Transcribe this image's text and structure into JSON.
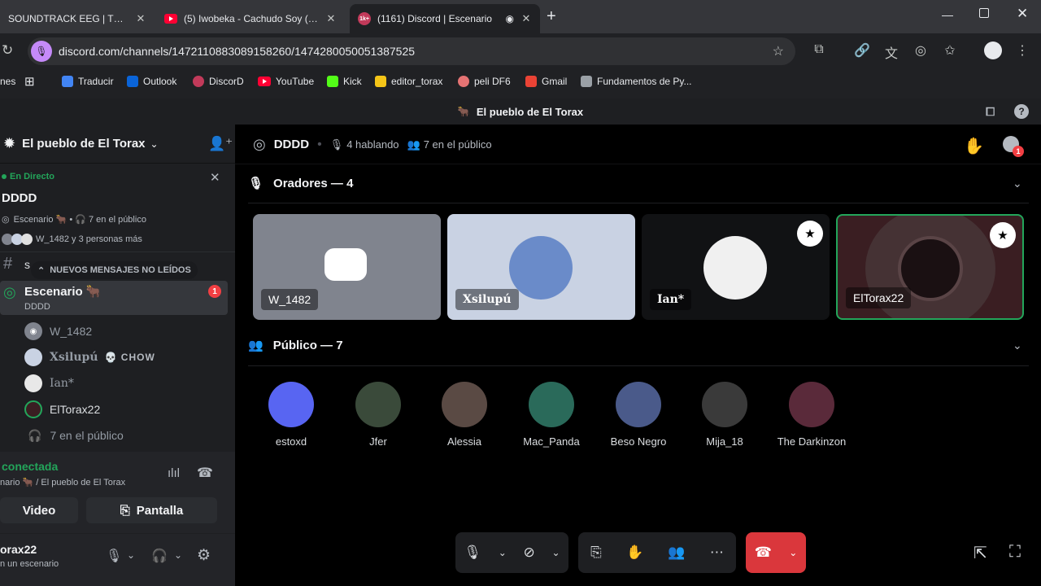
{
  "browser": {
    "tabs": [
      {
        "title": "SOUNDTRACK EEG | TROMP",
        "close": "✕"
      },
      {
        "title": "(5) Iwobeka - Cachudo Soy (Au",
        "close": "✕"
      },
      {
        "title": "(1161) Discord | Escenario",
        "close": "✕"
      }
    ],
    "tab_icon_label": "1k+",
    "new_tab": "+",
    "url": "discord.com/channels/1472110883089158260/1474280050051387525",
    "bookmarks": [
      "nes",
      "Traducir",
      "Outlook",
      "DiscorD",
      "YouTube",
      "Kick",
      "editor_torax",
      "peli DF6",
      "Gmail",
      "Fundamentos de Py..."
    ]
  },
  "window": {
    "title": "El pueblo de El Torax"
  },
  "sidebar": {
    "server_name": "El pueblo de El Torax",
    "live_label": "En Directo",
    "stage_title": "DDDD",
    "stage_info": "Escenario 🐂 • 🎧 7 en el público",
    "listeners_text": "W_1482 y 3 personas más",
    "truncated_channel": "s",
    "new_messages_pill": "NUEVOS MENSAJES NO LEÍDOS",
    "channel_name": "Escenario 🐂",
    "channel_badge": "1",
    "channel_topic": "DDDD",
    "members": [
      {
        "name": "W_1482"
      },
      {
        "name": "Xsilupú",
        "tag": "💀 CHOW"
      },
      {
        "name": "Ian*"
      },
      {
        "name": "ElTorax22"
      }
    ],
    "audience_line": "7 en el público",
    "connection": {
      "status": "conectada",
      "location": "nario 🐂 / El pueblo de El Torax",
      "video_label": "Video",
      "screen_label": "Pantalla"
    },
    "user": {
      "name": "orax22",
      "status": "n un escenario"
    }
  },
  "main": {
    "stage_name": "DDDD",
    "speaking": "4 hablando",
    "audience": "7 en el público",
    "notif_count": "1",
    "speakers_header": "Oradores — 4",
    "audience_header": "Público — 7",
    "speakers": [
      {
        "name": "W_1482",
        "color": "#80848e"
      },
      {
        "name": "Xsilupú",
        "color": "#c9d2e3"
      },
      {
        "name": "Ian*",
        "color": "#111214"
      },
      {
        "name": "ElTorax22",
        "color": "#3a1e22"
      }
    ],
    "audience_members": [
      {
        "name": "estoxd",
        "color": "#5865f2"
      },
      {
        "name": "Jfer",
        "color": "#3a4a3a"
      },
      {
        "name": "Alessia",
        "color": "#5a4a44"
      },
      {
        "name": "Mac_Panda",
        "color": "#2a6a5a"
      },
      {
        "name": "Beso Negro",
        "color": "#4a5a8a"
      },
      {
        "name": "Mija_18",
        "color": "#3a3a3a"
      },
      {
        "name": "The Darkinzon",
        "color": "#5a2a3a"
      }
    ]
  },
  "colors": {
    "accent": "#5865f2",
    "live": "#23a55a",
    "danger": "#da373c",
    "speaking": "#23a55a"
  }
}
